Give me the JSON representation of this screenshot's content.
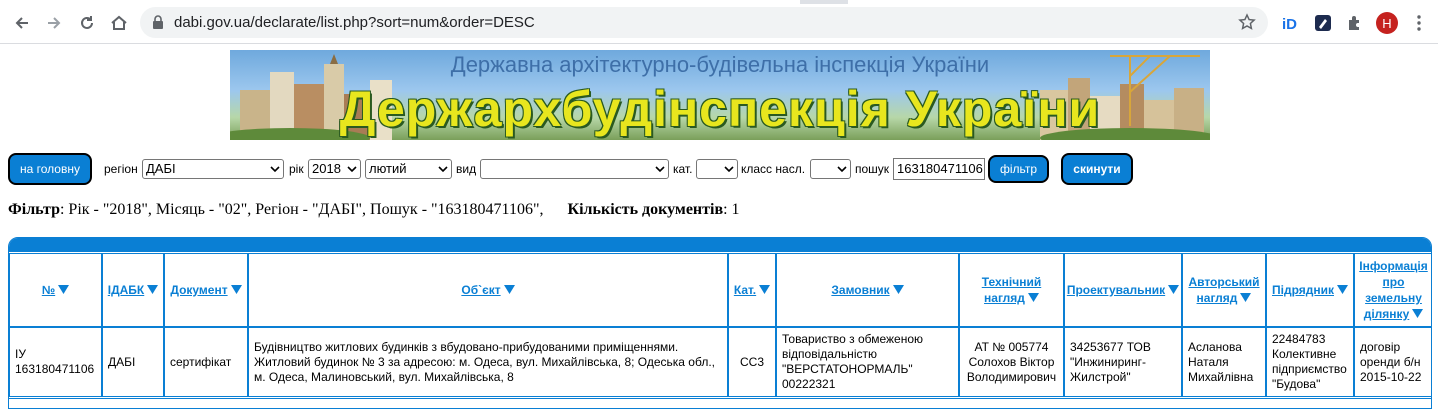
{
  "browser": {
    "url": "dabi.gov.ua/declarate/list.php?sort=num&order=DESC",
    "avatar_letter": "H",
    "extensions": [
      "id-extension-icon",
      "pen-extension-icon",
      "puzzle-icon"
    ]
  },
  "banner": {
    "subtitle": "Державна архітектурно-будівельна інспекція України",
    "title": "Держархбудінспекція України"
  },
  "filters": {
    "home_button": "на головну",
    "region_label": "регіон",
    "region_value": "ДАБІ",
    "year_label": "рік",
    "year_value": "2018",
    "month_value": "лютий",
    "type_label": "вид",
    "type_value": "",
    "cat_label": "кат.",
    "cat_value": "",
    "class_label": "класс насл.",
    "class_value": "",
    "search_label": "пошук",
    "search_value": "163180471106",
    "filter_button": "фільтр",
    "reset_button": "скинути"
  },
  "summary": {
    "filter_label": "Фільтр",
    "filter_text": ": Рік - \"2018\", Місяць - \"02\", Регіон - \"ДАБІ\", Пошук - \"163180471106\",",
    "count_label": "Кількість документів",
    "count_value": ": 1"
  },
  "table": {
    "headers": [
      {
        "l1": "№",
        "l2": "",
        "l3": "",
        "l4": "",
        "l5": ""
      },
      {
        "l1": "ІДАБК",
        "l2": "",
        "l3": "",
        "l4": "",
        "l5": ""
      },
      {
        "l1": "Документ",
        "l2": "",
        "l3": "",
        "l4": "",
        "l5": ""
      },
      {
        "l1": "Об`єкт",
        "l2": "",
        "l3": "",
        "l4": "",
        "l5": ""
      },
      {
        "l1": "Кат.",
        "l2": "",
        "l3": "",
        "l4": "",
        "l5": ""
      },
      {
        "l1": "Замовник",
        "l2": "",
        "l3": "",
        "l4": "",
        "l5": ""
      },
      {
        "l1": "Технічний",
        "l2": "нагляд",
        "l3": "",
        "l4": "",
        "l5": ""
      },
      {
        "l1": "Проектувальник",
        "l2": "",
        "l3": "",
        "l4": "",
        "l5": ""
      },
      {
        "l1": "Авторський",
        "l2": "нагляд",
        "l3": "",
        "l4": "",
        "l5": ""
      },
      {
        "l1": "Підрядник",
        "l2": "",
        "l3": "",
        "l4": "",
        "l5": ""
      },
      {
        "l1": "Інформація",
        "l2": "про",
        "l3": "земельну",
        "l4": "ділянку",
        "l5": ""
      }
    ],
    "row": [
      {
        "l1": "ІУ",
        "l2": "163180471106",
        "l3": "",
        "l4": "",
        "l5": ""
      },
      {
        "l1": "ДАБІ",
        "l2": "",
        "l3": "",
        "l4": "",
        "l5": ""
      },
      {
        "l1": "сертифікат",
        "l2": "",
        "l3": "",
        "l4": "",
        "l5": ""
      },
      {
        "l1": "Будівництво житлових будинків з вбудовано-прибудованими приміщеннями.",
        "l2": "Житловий будинок № 3 за адресою: м. Одеса, вул. Михайлівська, 8; Одеська обл.,",
        "l3": "м. Одеса, Малиновський, вул. Михайлівська, 8",
        "l4": "",
        "l5": ""
      },
      {
        "l1": "СС3",
        "l2": "",
        "l3": "",
        "l4": "",
        "l5": ""
      },
      {
        "l1": "Товариство з обмеженою",
        "l2": "відповідальністю",
        "l3": "\"ВЕРСТАТОНОРМАЛЬ\"",
        "l4": "00222321",
        "l5": ""
      },
      {
        "l1": "АТ № 005774",
        "l2": "Солохов Віктор",
        "l3": "Володимирович",
        "l4": "",
        "l5": ""
      },
      {
        "l1": "34253677 ТОВ",
        "l2": "\"Инжиниринг-",
        "l3": "Жилстрой\"",
        "l4": "",
        "l5": ""
      },
      {
        "l1": "Асланова",
        "l2": "Наталя",
        "l3": "Михайлівна",
        "l4": "",
        "l5": ""
      },
      {
        "l1": "22484783",
        "l2": "Колективне",
        "l3": "підприємство",
        "l4": "\"Будова\"",
        "l5": ""
      },
      {
        "l1": "договір",
        "l2": "оренди б/н",
        "l3": "2015-10-22",
        "l4": "",
        "l5": ""
      }
    ]
  },
  "colors": {
    "accent": "#0a7fd4",
    "banner_title": "#e8e61e",
    "avatar": "#c5221f"
  }
}
